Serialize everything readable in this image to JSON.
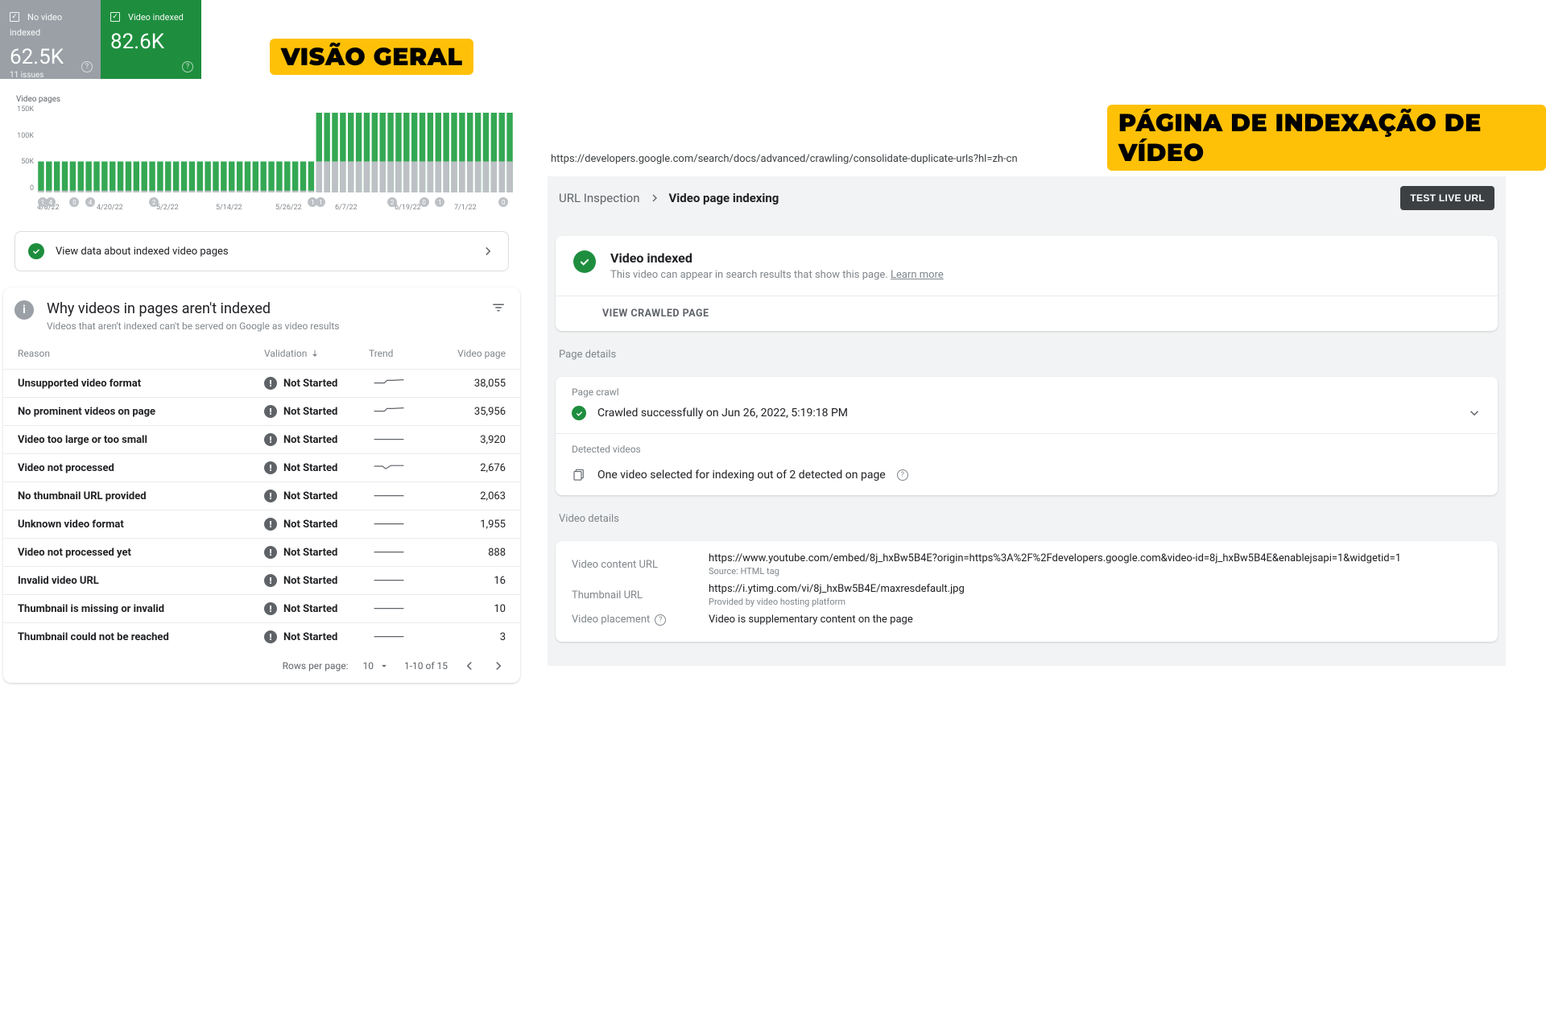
{
  "left": {
    "callout": "VISÃO GERAL",
    "cards": {
      "no_video": {
        "label": "No video indexed",
        "value": "62.5K",
        "sub": "11 issues"
      },
      "video": {
        "label": "Video indexed",
        "value": "82.6K"
      }
    },
    "cta": "View data about indexed video pages",
    "issues": {
      "title": "Why videos in pages aren't indexed",
      "subtitle": "Videos that aren't indexed can't be served on Google as video results",
      "cols": {
        "reason": "Reason",
        "validation": "Validation",
        "trend": "Trend",
        "pages": "Video page"
      },
      "status": "Not Started",
      "rows": [
        {
          "reason": "Unsupported video format",
          "pages": "38,055",
          "spark": "up"
        },
        {
          "reason": "No prominent videos on page",
          "pages": "35,956",
          "spark": "up"
        },
        {
          "reason": "Video too large or too small",
          "pages": "3,920",
          "spark": "flat"
        },
        {
          "reason": "Video not processed",
          "pages": "2,676",
          "spark": "dip"
        },
        {
          "reason": "No thumbnail URL provided",
          "pages": "2,063",
          "spark": "flat"
        },
        {
          "reason": "Unknown video format",
          "pages": "1,955",
          "spark": "flat"
        },
        {
          "reason": "Video not processed yet",
          "pages": "888",
          "spark": "flat"
        },
        {
          "reason": "Invalid video URL",
          "pages": "16",
          "spark": "flat"
        },
        {
          "reason": "Thumbnail is missing or invalid",
          "pages": "10",
          "spark": "flat"
        },
        {
          "reason": "Thumbnail could not be reached",
          "pages": "3",
          "spark": "flat"
        }
      ],
      "pager": {
        "rpp_label": "Rows per page:",
        "rpp": "10",
        "range": "1-10 of 15"
      }
    }
  },
  "right": {
    "callout": "PÁGINA DE INDEXAÇÃO DE VÍDEO",
    "url": "https://developers.google.com/search/docs/advanced/crawling/consolidate-duplicate-urls?hl=zh-cn",
    "breadcrumb": {
      "a": "URL Inspection",
      "b": "Video page indexing"
    },
    "test_btn": "TEST LIVE URL",
    "status": {
      "title": "Video indexed",
      "desc": "This video can appear in search results that show this page. ",
      "learn": "Learn more",
      "view_crawled": "VIEW CRAWLED PAGE"
    },
    "page_details_label": "Page details",
    "crawl": {
      "label": "Page crawl",
      "text": "Crawled successfully on Jun 26, 2022, 5:19:18 PM"
    },
    "detected": {
      "label": "Detected videos",
      "text": "One video selected for indexing out of 2 detected on page"
    },
    "video_details": {
      "label": "Video details",
      "content_url_k": "Video content URL",
      "content_url_v": "https://www.youtube.com/embed/8j_hxBw5B4E?origin=https%3A%2F%2Fdevelopers.google.com&video-id=8j_hxBw5B4E&enablejsapi=1&widgetid=1",
      "content_url_hint": "Source: HTML tag",
      "thumb_k": "Thumbnail URL",
      "thumb_v": "https://i.ytimg.com/vi/8j_hxBw5B4E/maxresdefault.jpg",
      "thumb_hint": "Provided by video hosting platform",
      "placement_k": "Video placement",
      "placement_v": "Video is supplementary content on the page"
    }
  },
  "chart_data": {
    "type": "bar",
    "title": "Video pages",
    "ylim": [
      0,
      150000
    ],
    "yticks": [
      "150K",
      "100K",
      "50K",
      "0"
    ],
    "xticks": [
      "4/8/22",
      "4/20/22",
      "5/2/22",
      "5/14/22",
      "5/26/22",
      "6/7/22",
      "6/19/22",
      "7/1/22"
    ],
    "series": [
      {
        "name": "No video indexed",
        "color": "#bdc1c6"
      },
      {
        "name": "Video indexed",
        "color": "#34a853"
      }
    ],
    "annotations_row": [
      "1",
      "4",
      "",
      "",
      "0",
      "",
      "4",
      "",
      "",
      "",
      "",
      "",
      "",
      "",
      "2",
      "",
      "",
      "",
      "",
      "",
      "",
      "",
      "",
      "",
      "",
      "",
      "",
      "",
      "",
      "",
      "",
      "",
      "",
      "",
      "1",
      "1",
      "",
      "",
      "",
      "",
      "",
      "",
      "",
      "",
      "2",
      "",
      "",
      "",
      "0",
      "",
      "1",
      "",
      "",
      "",
      "",
      "",
      "",
      "",
      "0",
      ""
    ],
    "bars": [
      {
        "g": 33,
        "h": 35
      },
      {
        "g": 33,
        "h": 35
      },
      {
        "g": 33,
        "h": 35
      },
      {
        "g": 33,
        "h": 35
      },
      {
        "g": 33,
        "h": 35
      },
      {
        "g": 33,
        "h": 35
      },
      {
        "g": 33,
        "h": 35
      },
      {
        "g": 33,
        "h": 35
      },
      {
        "g": 33,
        "h": 35
      },
      {
        "g": 33,
        "h": 35
      },
      {
        "g": 33,
        "h": 35
      },
      {
        "g": 33,
        "h": 35
      },
      {
        "g": 33,
        "h": 35
      },
      {
        "g": 33,
        "h": 35
      },
      {
        "g": 33,
        "h": 35
      },
      {
        "g": 33,
        "h": 35
      },
      {
        "g": 33,
        "h": 35
      },
      {
        "g": 33,
        "h": 35
      },
      {
        "g": 33,
        "h": 35
      },
      {
        "g": 33,
        "h": 35
      },
      {
        "g": 33,
        "h": 35
      },
      {
        "g": 33,
        "h": 35
      },
      {
        "g": 33,
        "h": 35
      },
      {
        "g": 33,
        "h": 35
      },
      {
        "g": 33,
        "h": 35
      },
      {
        "g": 33,
        "h": 35
      },
      {
        "g": 33,
        "h": 35
      },
      {
        "g": 33,
        "h": 35
      },
      {
        "g": 33,
        "h": 35
      },
      {
        "g": 33,
        "h": 35
      },
      {
        "g": 33,
        "h": 35
      },
      {
        "g": 33,
        "h": 35
      },
      {
        "g": 33,
        "h": 35
      },
      {
        "g": 33,
        "h": 35
      },
      {
        "g": 33,
        "h": 35
      },
      {
        "g": 55,
        "h": 90
      },
      {
        "g": 55,
        "h": 90
      },
      {
        "g": 55,
        "h": 90
      },
      {
        "g": 55,
        "h": 90
      },
      {
        "g": 55,
        "h": 90
      },
      {
        "g": 55,
        "h": 90
      },
      {
        "g": 55,
        "h": 90
      },
      {
        "g": 55,
        "h": 90
      },
      {
        "g": 55,
        "h": 90
      },
      {
        "g": 55,
        "h": 90
      },
      {
        "g": 55,
        "h": 90
      },
      {
        "g": 55,
        "h": 90
      },
      {
        "g": 55,
        "h": 90
      },
      {
        "g": 55,
        "h": 90
      },
      {
        "g": 55,
        "h": 90
      },
      {
        "g": 55,
        "h": 90
      },
      {
        "g": 55,
        "h": 90
      },
      {
        "g": 55,
        "h": 90
      },
      {
        "g": 55,
        "h": 90
      },
      {
        "g": 55,
        "h": 90
      },
      {
        "g": 55,
        "h": 90
      },
      {
        "g": 55,
        "h": 90
      },
      {
        "g": 55,
        "h": 90
      },
      {
        "g": 55,
        "h": 90
      },
      {
        "g": 55,
        "h": 90
      }
    ]
  }
}
